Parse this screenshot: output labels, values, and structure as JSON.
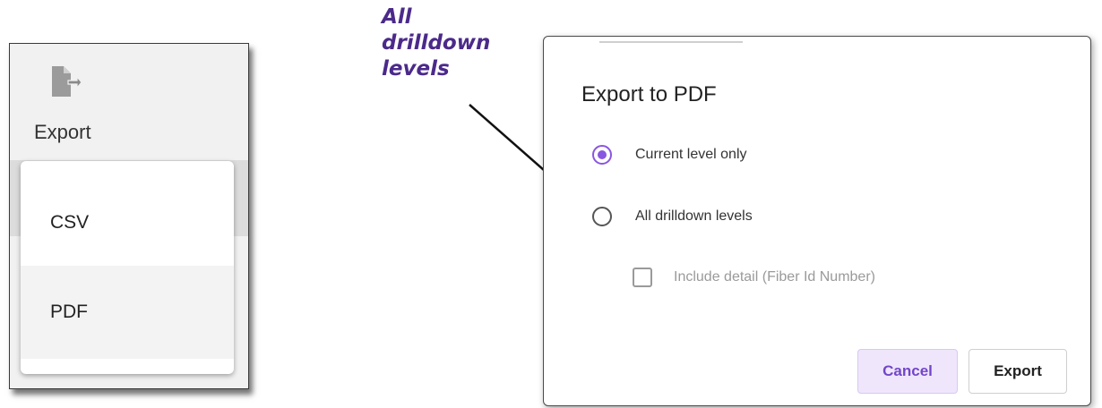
{
  "toolbar": {
    "export_label": "Export",
    "export_icon": "file-export-icon"
  },
  "export_menu": {
    "items": [
      {
        "label": "CSV"
      },
      {
        "label": "PDF"
      }
    ]
  },
  "annotation": {
    "lines": [
      "All",
      "drilldown",
      "levels"
    ]
  },
  "dialog": {
    "title": "Export to PDF",
    "options": [
      {
        "label": "Current level only",
        "selected": true
      },
      {
        "label": "All drilldown levels",
        "selected": false
      }
    ],
    "include_detail": {
      "label": "Include detail (Fiber Id Number)",
      "checked": false
    },
    "cancel_label": "Cancel",
    "export_label": "Export"
  },
  "colors": {
    "accent": "#8a56e0",
    "annotation": "#4b2a8a",
    "cancel_bg": "#efe6fc"
  }
}
